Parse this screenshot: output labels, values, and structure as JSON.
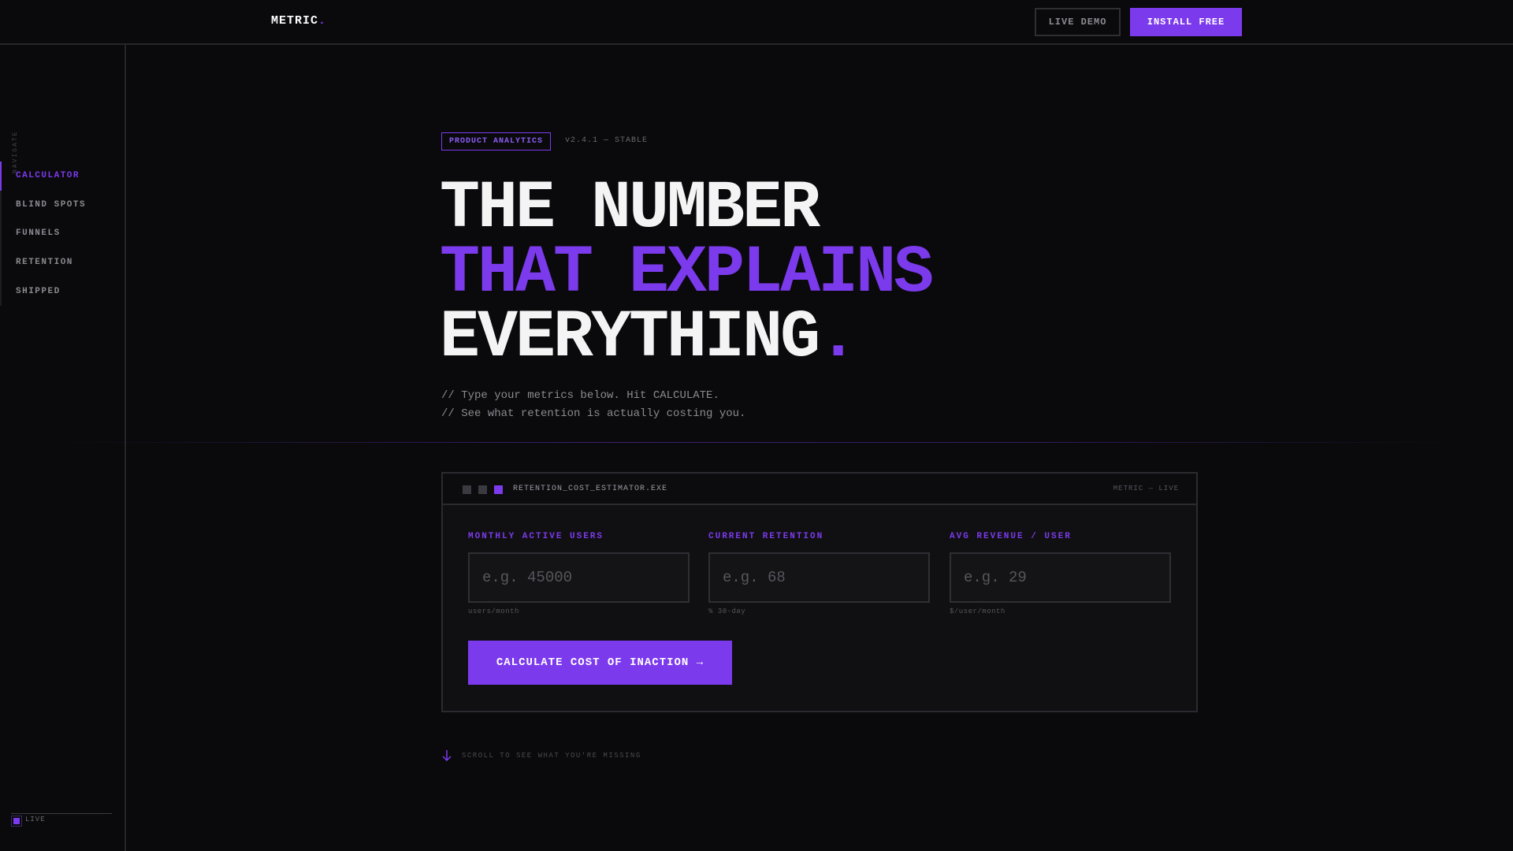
{
  "header": {
    "logo": "METRIC",
    "logo_dot": ".",
    "live_demo_label": "LIVE DEMO",
    "install_label": "INSTALL FREE"
  },
  "sidebar": {
    "caption": "NAVIGATE",
    "items": [
      {
        "label": "CALCULATOR",
        "active": true
      },
      {
        "label": "BLIND SPOTS",
        "active": false
      },
      {
        "label": "FUNNELS",
        "active": false
      },
      {
        "label": "RETENTION",
        "active": false
      },
      {
        "label": "SHIPPED",
        "active": false
      }
    ],
    "status_label": "LIVE"
  },
  "hero": {
    "tag": "PRODUCT ANALYTICS",
    "version": "v2.4.1 — STABLE",
    "headline_line1": "THE NUMBER",
    "headline_line2": "THAT EXPLAINS",
    "headline_line3": "EVERYTHING",
    "headline_dot": ".",
    "sub_line1": "// Type your metrics below. Hit CALCULATE.",
    "sub_line2": "// See what retention is actually costing you."
  },
  "calculator": {
    "window_title": "RETENTION_COST_ESTIMATOR.EXE",
    "window_status": "METRIC — LIVE",
    "fields": [
      {
        "label": "MONTHLY ACTIVE USERS",
        "placeholder": "e.g. 45000",
        "value": "",
        "hint": "users/month"
      },
      {
        "label": "CURRENT RETENTION",
        "placeholder": "e.g. 68",
        "value": "",
        "hint": "% 30-day"
      },
      {
        "label": "AVG REVENUE / USER",
        "placeholder": "e.g. 29",
        "value": "",
        "hint": "$/user/month"
      }
    ],
    "button_label": "CALCULATE COST OF INACTION →"
  },
  "scroll_hint": "SCROLL TO SEE WHAT YOU'RE MISSING",
  "colors": {
    "accent": "#7c3aed",
    "background": "#0a0a0c",
    "panel": "#101013"
  }
}
